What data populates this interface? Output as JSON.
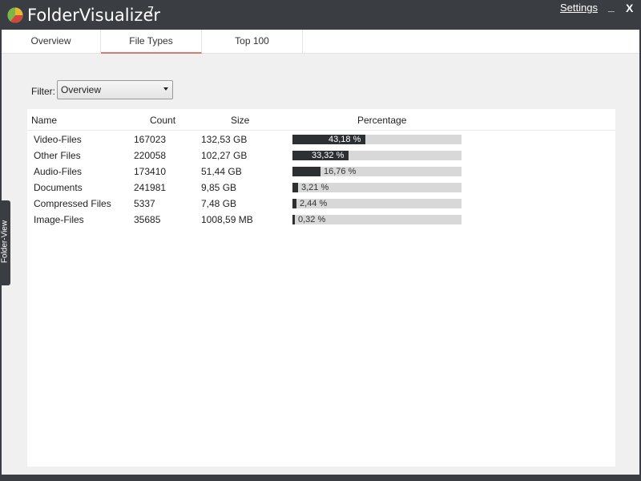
{
  "app": {
    "name": "FolderVisualizer",
    "version": "7",
    "settings_label": "Settings",
    "minimize_glyph": "_",
    "close_glyph": "X"
  },
  "tabs": [
    {
      "label": "Overview"
    },
    {
      "label": "File Types",
      "active": true
    },
    {
      "label": "Top 100"
    }
  ],
  "filter": {
    "label": "Filter:",
    "value": "Overview"
  },
  "table": {
    "columns": {
      "name": "Name",
      "count": "Count",
      "size": "Size",
      "percentage": "Percentage"
    },
    "rows": [
      {
        "name": "Video-Files",
        "count": "167023",
        "size": "132,53 GB",
        "percentage_label": "43,18 %",
        "percentage": 43.18
      },
      {
        "name": "Other Files",
        "count": "220058",
        "size": "102,27 GB",
        "percentage_label": "33,32 %",
        "percentage": 33.32
      },
      {
        "name": "Audio-Files",
        "count": "173410",
        "size": "51,44 GB",
        "percentage_label": "16,76 %",
        "percentage": 16.76
      },
      {
        "name": "Documents",
        "count": "241981",
        "size": "9,85 GB",
        "percentage_label": "3,21 %",
        "percentage": 3.21
      },
      {
        "name": "Compressed Files",
        "count": "5337",
        "size": "7,48 GB",
        "percentage_label": "2,44 %",
        "percentage": 2.44
      },
      {
        "name": "Image-Files",
        "count": "35685",
        "size": "1008,59 MB",
        "percentage_label": "0,32 %",
        "percentage": 0.32
      }
    ]
  },
  "side_panel": {
    "label": "Folder-View"
  },
  "colors": {
    "accent": "#d77a73",
    "bar_fill": "#2d3033",
    "bar_track": "#d8d8d8",
    "chrome": "#3a3d41"
  }
}
